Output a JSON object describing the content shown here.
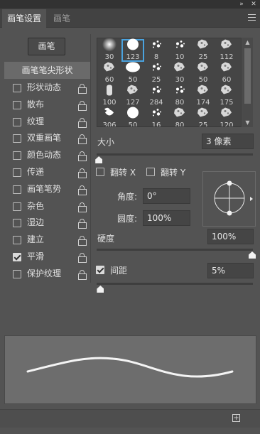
{
  "window": {
    "collapse_icon": "double-chevron-icon",
    "close_icon": "close-icon"
  },
  "tabs": [
    {
      "label": "画笔设置",
      "active": true
    },
    {
      "label": "画笔",
      "active": false
    }
  ],
  "brush_button_label": "画笔",
  "settings": {
    "tip_shape_label": "画笔笔尖形状",
    "options": [
      {
        "label": "形状动态",
        "checked": false
      },
      {
        "label": "散布",
        "checked": false
      },
      {
        "label": "纹理",
        "checked": false
      },
      {
        "label": "双重画笔",
        "checked": false
      },
      {
        "label": "颜色动态",
        "checked": false
      },
      {
        "label": "传递",
        "checked": false
      },
      {
        "label": "画笔笔势",
        "checked": false
      },
      {
        "label": "杂色",
        "checked": false
      },
      {
        "label": "湿边",
        "checked": false
      },
      {
        "label": "建立",
        "checked": false
      },
      {
        "label": "平滑",
        "checked": true
      },
      {
        "label": "保护纹理",
        "checked": false
      }
    ]
  },
  "brush_presets": {
    "selected_index": 1,
    "items": [
      {
        "size": "30",
        "shape": "soft-round"
      },
      {
        "size": "123",
        "shape": "hard-round"
      },
      {
        "size": "8",
        "shape": "splatter"
      },
      {
        "size": "10",
        "shape": "splatter"
      },
      {
        "size": "25",
        "shape": "texture"
      },
      {
        "size": "112",
        "shape": "texture"
      },
      {
        "size": "60",
        "shape": "texture"
      },
      {
        "size": "50",
        "shape": "blob"
      },
      {
        "size": "25",
        "shape": "splatter"
      },
      {
        "size": "30",
        "shape": "texture"
      },
      {
        "size": "50",
        "shape": "texture"
      },
      {
        "size": "60",
        "shape": "texture"
      },
      {
        "size": "100",
        "shape": "bristle"
      },
      {
        "size": "127",
        "shape": "texture"
      },
      {
        "size": "284",
        "shape": "splatter"
      },
      {
        "size": "80",
        "shape": "splatter"
      },
      {
        "size": "174",
        "shape": "texture"
      },
      {
        "size": "175",
        "shape": "texture"
      },
      {
        "size": "306",
        "shape": "leaf"
      },
      {
        "size": "50",
        "shape": "hard-round"
      },
      {
        "size": "16",
        "shape": "splatter"
      },
      {
        "size": "80",
        "shape": "texture"
      },
      {
        "size": "25",
        "shape": "texture"
      },
      {
        "size": "120",
        "shape": "texture"
      }
    ]
  },
  "size": {
    "label": "大小",
    "value": "3 像素",
    "level": 0.01
  },
  "flip_x": {
    "label": "翻转 X",
    "checked": false
  },
  "flip_y": {
    "label": "翻转 Y",
    "checked": false
  },
  "angle": {
    "label": "角度:",
    "value": "0°"
  },
  "roundness": {
    "label": "圆度:",
    "value": "100%"
  },
  "hardness": {
    "label": "硬度",
    "value": "100%",
    "level": 1.0
  },
  "spacing": {
    "label": "间距",
    "value": "5%",
    "checked": true,
    "level": 0.02
  },
  "footer": {
    "new_preset_icon": "new-brush-icon"
  }
}
